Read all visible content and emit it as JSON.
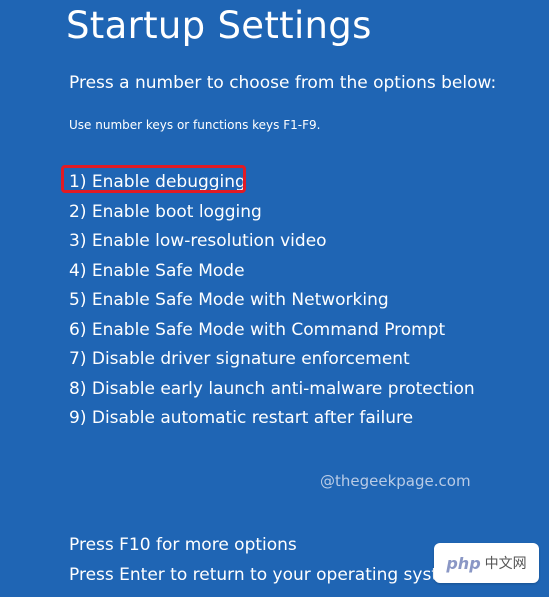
{
  "screen": {
    "title": "Startup Settings",
    "instruction": "Press a number to choose from the options below:",
    "hint": "Use number keys or functions keys F1-F9."
  },
  "options": [
    {
      "label": "1) Enable debugging",
      "highlighted": true
    },
    {
      "label": "2) Enable boot logging",
      "highlighted": false
    },
    {
      "label": "3) Enable low-resolution video",
      "highlighted": false
    },
    {
      "label": "4) Enable Safe Mode",
      "highlighted": false
    },
    {
      "label": "5) Enable Safe Mode with Networking",
      "highlighted": false
    },
    {
      "label": "6) Enable Safe Mode with Command Prompt",
      "highlighted": false
    },
    {
      "label": "7) Disable driver signature enforcement",
      "highlighted": false
    },
    {
      "label": "8) Disable early launch anti-malware protection",
      "highlighted": false
    },
    {
      "label": "9) Disable automatic restart after failure",
      "highlighted": false
    }
  ],
  "watermark": "@thegeekpage.com",
  "footer": {
    "more_options": "Press F10 for more options",
    "return": "Press Enter to return to your operating system"
  },
  "badge": {
    "brand": "php",
    "lang": "中文网"
  },
  "colors": {
    "background": "#1f65b4",
    "text": "#ffffff",
    "highlight_border": "#e21b24"
  }
}
